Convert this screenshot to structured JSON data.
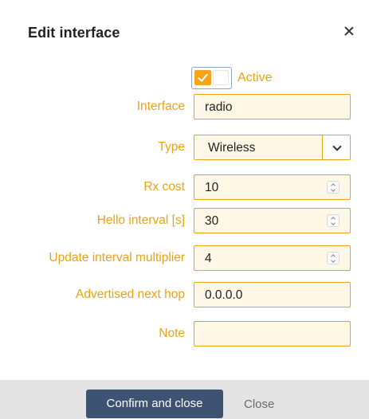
{
  "dialog": {
    "title": "Edit interface",
    "close_icon": "close-icon"
  },
  "active": {
    "label": "Active",
    "checked": true
  },
  "fields": {
    "interface": {
      "label": "Interface",
      "value": "radio"
    },
    "type": {
      "label": "Type",
      "value": "Wireless"
    },
    "rx_cost": {
      "label": "Rx cost",
      "value": "10"
    },
    "hello_interval": {
      "label": "Hello interval [s]",
      "value": "30"
    },
    "update_multiplier": {
      "label": "Update interval multiplier",
      "value": "4"
    },
    "next_hop": {
      "label": "Advertised next hop",
      "value": "0.0.0.0"
    },
    "note": {
      "label": "Note",
      "value": ""
    }
  },
  "footer": {
    "confirm_label": "Confirm and close",
    "close_label": "Close"
  },
  "colors": {
    "accent": "#e8a317",
    "field_bg": "#fff8e6",
    "primary_button": "#3e5271",
    "footer_bg": "#e4e4e4"
  }
}
